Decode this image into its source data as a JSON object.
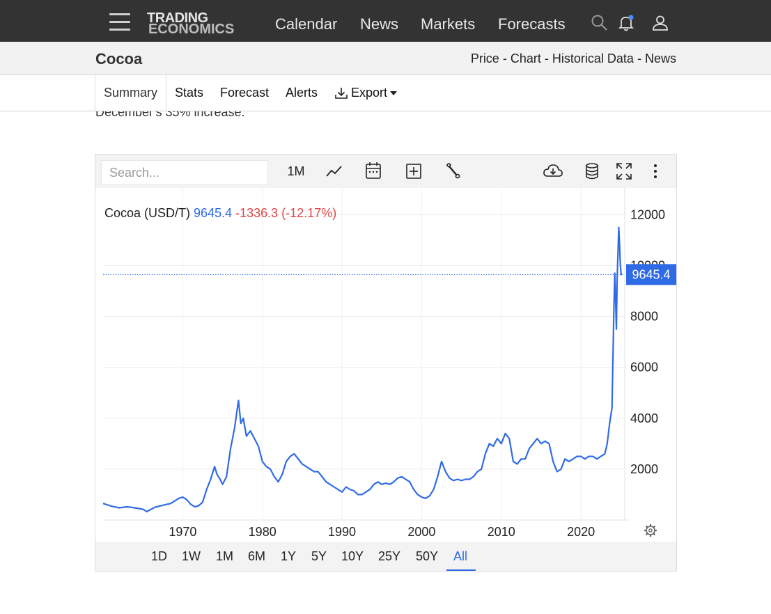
{
  "topnav": {
    "logo_line1": "TRADING",
    "logo_line2": "ECONOMICS",
    "links": [
      "Calendar",
      "News",
      "Markets",
      "Forecasts"
    ],
    "icons": [
      "menu-icon",
      "search-icon",
      "bell-icon",
      "user-icon"
    ],
    "notification_dot_color": "#4a8cff"
  },
  "titlebar": {
    "title": "Cocoa",
    "crumbs": [
      "Price",
      "Chart",
      "Historical Data",
      "News"
    ],
    "separator": "-"
  },
  "tabs": {
    "items": [
      "Summary",
      "Stats",
      "Forecast",
      "Alerts",
      "Export"
    ],
    "active": "Summary"
  },
  "body": {
    "partial_text": "December's 35% increase."
  },
  "chart_panel": {
    "search_placeholder": "Search...",
    "interval_label": "1M",
    "toolbar_icons": [
      "line-chart-icon",
      "calendar-icon",
      "add-icon",
      "wrench-icon",
      "cloud-download-icon",
      "database-icon",
      "fullscreen-icon",
      "more-icon"
    ],
    "legend": {
      "name": "Cocoa (USD/T)",
      "price": "9645.4",
      "change": "-1336.3 (-12.17%)"
    },
    "last_price_badge": "9645.4",
    "ranges": [
      "1D",
      "1W",
      "1M",
      "6M",
      "1Y",
      "5Y",
      "10Y",
      "25Y",
      "50Y",
      "All"
    ],
    "active_range": "All",
    "accent_color": "#2f6be6",
    "negative_color": "#e04545"
  },
  "chart_data": {
    "type": "line",
    "title": "",
    "xlabel": "",
    "ylabel": "",
    "x_ticks": [
      "1970",
      "1980",
      "1990",
      "2000",
      "2010",
      "2020"
    ],
    "y_ticks": [
      2000,
      4000,
      6000,
      8000,
      10000,
      12000
    ],
    "xlim": [
      1960,
      2025.5
    ],
    "ylim": [
      0,
      12500
    ],
    "grid": true,
    "last_value": 9645.4,
    "series": [
      {
        "name": "Cocoa (USD/T)",
        "x": [
          1960.0,
          1961.0,
          1962.0,
          1963.0,
          1964.0,
          1965.0,
          1965.5,
          1966.5,
          1967.5,
          1968.5,
          1969.0,
          1969.5,
          1970.0,
          1970.5,
          1971.0,
          1971.5,
          1972.0,
          1972.5,
          1973.0,
          1973.5,
          1974.0,
          1974.3,
          1974.7,
          1975.0,
          1975.5,
          1976.0,
          1976.5,
          1977.0,
          1977.3,
          1977.6,
          1978.0,
          1978.5,
          1979.0,
          1979.5,
          1980.0,
          1980.5,
          1981.0,
          1981.5,
          1982.0,
          1982.5,
          1983.0,
          1983.5,
          1984.0,
          1984.5,
          1985.0,
          1985.5,
          1986.0,
          1986.5,
          1987.0,
          1987.5,
          1988.0,
          1988.5,
          1989.0,
          1989.5,
          1990.0,
          1990.5,
          1991.0,
          1991.5,
          1992.0,
          1992.5,
          1993.0,
          1993.5,
          1994.0,
          1994.5,
          1995.0,
          1995.5,
          1996.0,
          1996.5,
          1997.0,
          1997.5,
          1998.0,
          1998.5,
          1999.0,
          1999.5,
          2000.0,
          2000.5,
          2001.0,
          2001.5,
          2002.0,
          2002.5,
          2003.0,
          2003.5,
          2004.0,
          2004.5,
          2005.0,
          2005.5,
          2006.0,
          2006.5,
          2007.0,
          2007.5,
          2008.0,
          2008.5,
          2009.0,
          2009.5,
          2010.0,
          2010.5,
          2011.0,
          2011.5,
          2012.0,
          2012.5,
          2013.0,
          2013.5,
          2014.0,
          2014.5,
          2015.0,
          2015.5,
          2016.0,
          2016.5,
          2017.0,
          2017.5,
          2018.0,
          2018.5,
          2019.0,
          2019.5,
          2020.0,
          2020.5,
          2021.0,
          2021.5,
          2022.0,
          2022.5,
          2023.0,
          2023.3,
          2023.6,
          2023.9,
          2024.0,
          2024.15,
          2024.25,
          2024.35,
          2024.45,
          2024.55,
          2024.65,
          2024.75,
          2024.85,
          2024.95,
          2025.05,
          2025.15
        ],
        "values": [
          650,
          550,
          480,
          520,
          480,
          420,
          330,
          500,
          580,
          650,
          750,
          850,
          900,
          800,
          620,
          520,
          560,
          700,
          1200,
          1600,
          2100,
          1800,
          1600,
          1400,
          1700,
          2800,
          3600,
          4700,
          3800,
          4000,
          3300,
          3500,
          3200,
          2900,
          2300,
          2100,
          2000,
          1700,
          1500,
          1800,
          2300,
          2500,
          2600,
          2400,
          2200,
          2100,
          2000,
          1900,
          1900,
          1700,
          1500,
          1400,
          1300,
          1200,
          1100,
          1300,
          1200,
          1150,
          1000,
          1000,
          1100,
          1200,
          1400,
          1500,
          1400,
          1450,
          1400,
          1500,
          1650,
          1700,
          1600,
          1500,
          1200,
          1000,
          900,
          850,
          950,
          1200,
          1700,
          2300,
          1900,
          1650,
          1550,
          1600,
          1550,
          1600,
          1600,
          1700,
          1900,
          2000,
          2600,
          3000,
          2900,
          3200,
          3000,
          3400,
          3200,
          2300,
          2200,
          2400,
          2400,
          2800,
          3000,
          3200,
          3000,
          3100,
          3000,
          2300,
          1900,
          2000,
          2400,
          2300,
          2400,
          2500,
          2500,
          2400,
          2500,
          2500,
          2400,
          2500,
          2600,
          3000,
          3800,
          4400,
          6000,
          8500,
          9700,
          8800,
          7500,
          9500,
          10500,
          11500,
          10800,
          10000,
          9645.4,
          9645.4
        ]
      }
    ]
  }
}
